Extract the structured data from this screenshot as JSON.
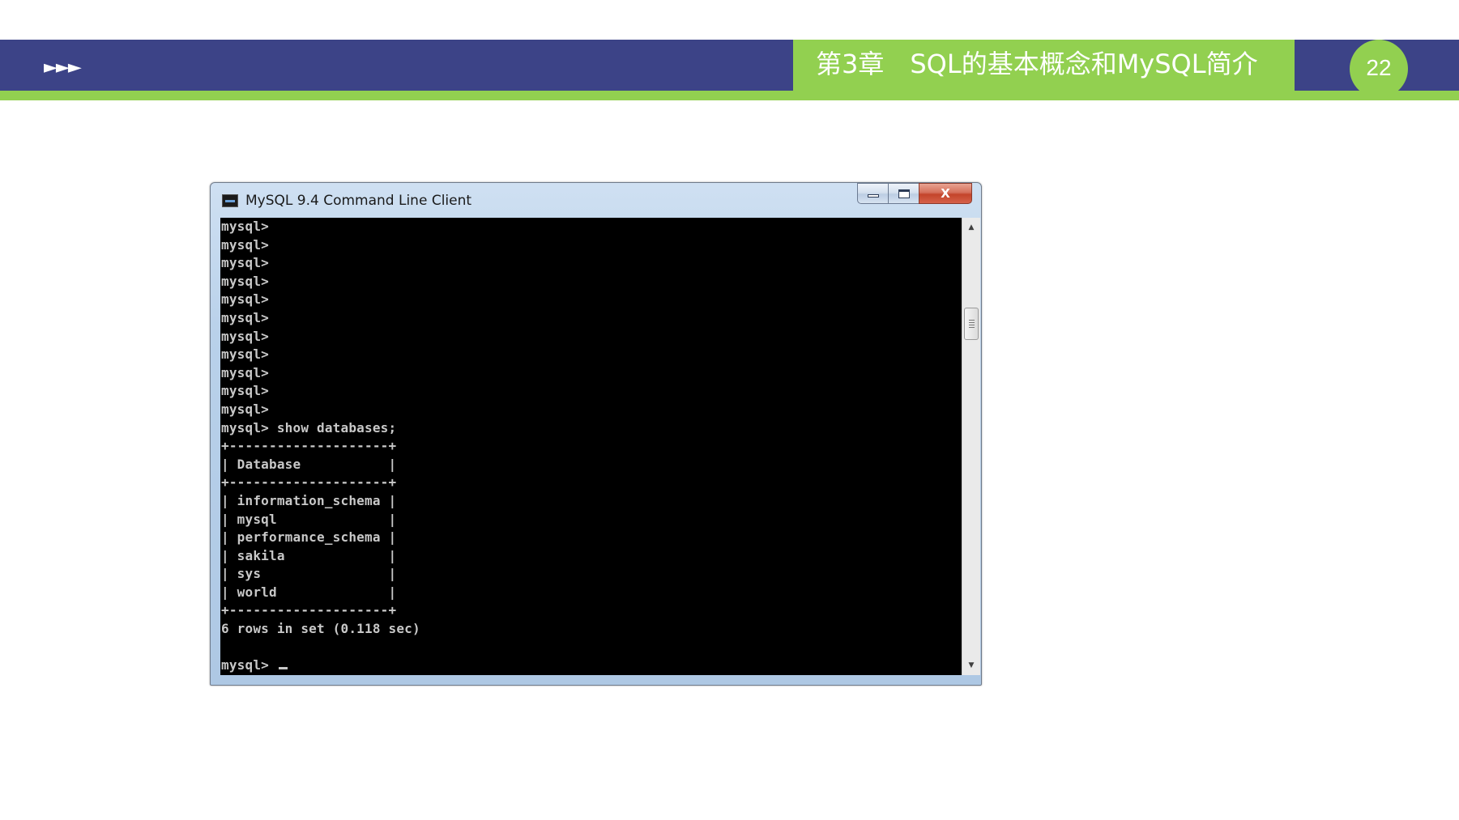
{
  "slide": {
    "nav_arrows": "►►►",
    "chapter_title": "第3章　SQL的基本概念和MySQL简介",
    "page_number": "22",
    "colors": {
      "banner": "#3c4387",
      "accent": "#92d050"
    }
  },
  "window": {
    "title": "MySQL 9.4 Command Line Client",
    "icon": "mysql-console-icon",
    "caption_buttons": {
      "minimize": "minimize-icon",
      "maximize": "maximize-icon",
      "close": "X"
    }
  },
  "console": {
    "lines": [
      "mysql>",
      "mysql>",
      "mysql>",
      "mysql>",
      "mysql>",
      "mysql>",
      "mysql>",
      "mysql>",
      "mysql>",
      "mysql>",
      "mysql>",
      "mysql> show databases;",
      "+--------------------+",
      "| Database           |",
      "+--------------------+",
      "| information_schema |",
      "| mysql              |",
      "| performance_schema |",
      "| sakila             |",
      "| sys                |",
      "| world              |",
      "+--------------------+",
      "6 rows in set (0.118 sec)",
      "",
      "mysql> "
    ]
  },
  "scrollbar": {
    "up_icon": "▲",
    "down_icon": "▼"
  }
}
